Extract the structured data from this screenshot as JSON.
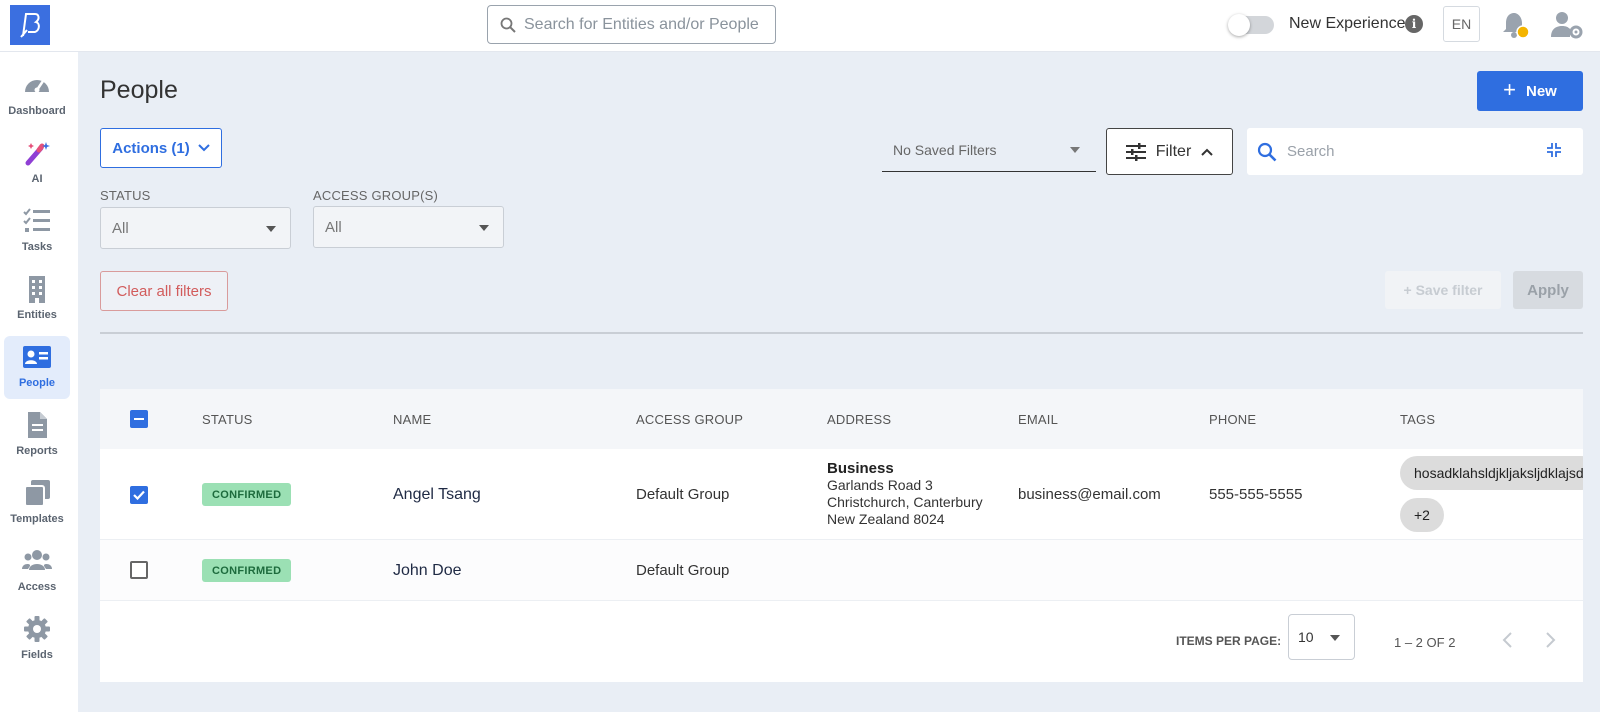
{
  "topbar": {
    "search_placeholder": "Search for Entities and/or People",
    "new_experience_label": "New Experience",
    "info_glyph": "i",
    "language": "EN",
    "icons": [
      "logo-icon",
      "search-icon",
      "info-icon",
      "bell-icon",
      "user-settings-icon"
    ]
  },
  "sidebar": {
    "items": [
      {
        "label": "Dashboard",
        "icon": "speedometer-icon"
      },
      {
        "label": "AI",
        "icon": "magic-wand-icon"
      },
      {
        "label": "Tasks",
        "icon": "checklist-icon"
      },
      {
        "label": "Entities",
        "icon": "building-icon"
      },
      {
        "label": "People",
        "icon": "id-card-icon",
        "active": true
      },
      {
        "label": "Reports",
        "icon": "document-icon"
      },
      {
        "label": "Templates",
        "icon": "stacked-pages-icon"
      },
      {
        "label": "Access",
        "icon": "people-group-icon"
      },
      {
        "label": "Fields",
        "icon": "gear-icon"
      }
    ]
  },
  "page": {
    "title": "People",
    "new_button_plus": "+",
    "new_button_label": "New",
    "actions_label": "Actions (1)"
  },
  "filters": {
    "saved_filters_placeholder": "No Saved Filters",
    "filter_button_label": "Filter",
    "search_placeholder": "Search",
    "status_label": "STATUS",
    "status_value": "All",
    "access_group_label": "ACCESS GROUP(S)",
    "access_group_value": "All",
    "clear_label": "Clear all filters",
    "save_filter_label": "+ Save filter",
    "apply_label": "Apply"
  },
  "table": {
    "columns": [
      "STATUS",
      "NAME",
      "ACCESS GROUP",
      "ADDRESS",
      "EMAIL",
      "PHONE",
      "TAGS"
    ],
    "rows": [
      {
        "checked": true,
        "status": "CONFIRMED",
        "name": "Angel Tsang",
        "access_group": "Default Group",
        "address": {
          "type": "Business",
          "line1": "Garlands Road 3",
          "line2": "Christchurch, Canterbury",
          "line3": "New Zealand 8024"
        },
        "email": "business@email.com",
        "phone": "555-555-5555",
        "tags": [
          "hosadklahsldjkljaksljdklajsd",
          "+2"
        ]
      },
      {
        "checked": false,
        "status": "CONFIRMED",
        "name": "John Doe",
        "access_group": "Default Group",
        "email": "",
        "phone": "",
        "tags": []
      }
    ]
  },
  "pagination": {
    "items_per_page_label": "ITEMS PER PAGE:",
    "items_per_page": "10",
    "range": "1 – 2 OF 2"
  },
  "colors": {
    "primary": "#2f6ee0",
    "background": "#e9eef5",
    "confirmed_badge": "#9be0b4",
    "clear_filters_red": "#d25c5c"
  }
}
